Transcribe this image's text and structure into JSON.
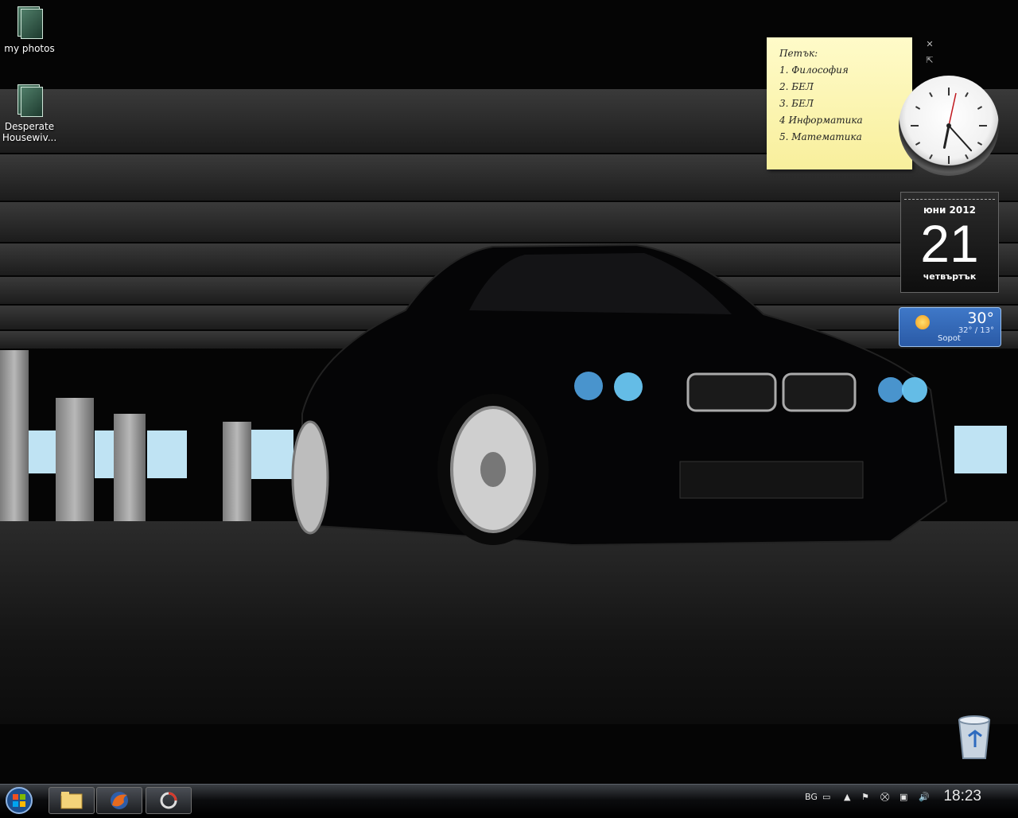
{
  "desktop": {
    "icons": [
      {
        "label": "my photos"
      },
      {
        "label_line1": "Desperate",
        "label_line2": "Housewiv..."
      }
    ],
    "recycle_bin": {
      "icon": "recycle-bin-icon"
    }
  },
  "gadgets": {
    "notes": {
      "lines": [
        "Петък:",
        "1. Философия",
        "2. БЕЛ",
        "3. БЕЛ",
        "4 Информатика",
        "5. Математика"
      ]
    },
    "clock": {
      "hour": 6,
      "minute": 23
    },
    "calendar": {
      "month_year": "юни 2012",
      "day": "21",
      "weekday": "четвъртък"
    },
    "weather": {
      "temperature": "30°",
      "range": "32° / 13°",
      "city": "Sopot"
    }
  },
  "taskbar": {
    "start_icon": "windows-start-orb-icon",
    "quick_launch": [
      "explorer-folder-icon",
      "firefox-icon",
      "app-icon"
    ],
    "tray": {
      "language": "BG",
      "time": "18:23"
    }
  },
  "colors": {
    "weather_bg": "#2a5aa6",
    "note_bg": "#fff7b8"
  }
}
